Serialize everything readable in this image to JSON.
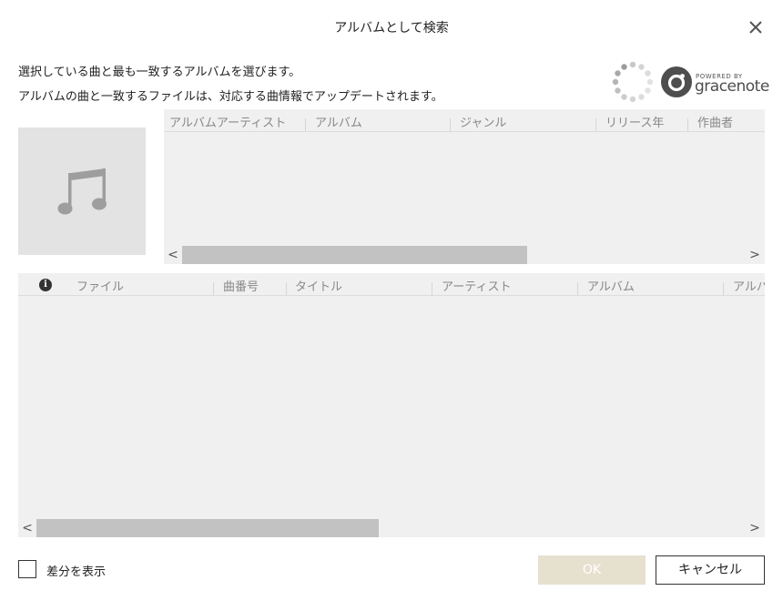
{
  "dialog": {
    "title": "アルバムとして検索",
    "instructions": [
      "選択している曲と最も一致するアルバムを選びます。",
      "アルバムの曲と一致するファイルは、対応する曲情報でアップデートされます。"
    ]
  },
  "logo": {
    "powered_by": "POWERED BY",
    "brand": "gracenote"
  },
  "album_grid": {
    "columns": [
      "アルバムアーティスト",
      "アルバム",
      "ジャンル",
      "リリース年",
      "作曲者"
    ],
    "rows": []
  },
  "file_grid": {
    "columns": [
      "ファイル",
      "曲番号",
      "タイトル",
      "アーティスト",
      "アルバム",
      "アルバ"
    ],
    "rows": []
  },
  "scroll": {
    "left_arrow": "<",
    "right_arrow": ">"
  },
  "footer": {
    "show_diff_label": "差分を表示",
    "show_diff_checked": false,
    "ok_label": "OK",
    "cancel_label": "キャンセル"
  },
  "icons": {
    "close": "close-icon",
    "spinner": "loading-spinner-icon",
    "music_note": "music-note-icon",
    "info": "info-icon"
  },
  "colors": {
    "grid_background": "#f0f0f0",
    "art_background": "#e3e3e3",
    "ok_disabled": "#e6e0cf",
    "scroll_thumb": "#c2c2c2"
  }
}
